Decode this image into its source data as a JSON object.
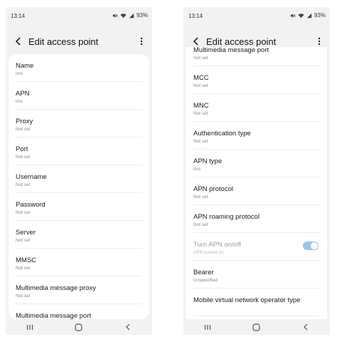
{
  "screens": [
    {
      "status": {
        "time": "13:14",
        "battery": "93%"
      },
      "title": "Edit access point",
      "items": [
        {
          "label": "Name",
          "value": "ims"
        },
        {
          "label": "APN",
          "value": "ims"
        },
        {
          "label": "Proxy",
          "value": "Not set"
        },
        {
          "label": "Port",
          "value": "Not set"
        },
        {
          "label": "Username",
          "value": "Not set"
        },
        {
          "label": "Password",
          "value": "Not set"
        },
        {
          "label": "Server",
          "value": "Not set"
        },
        {
          "label": "MMSC",
          "value": "Not set"
        },
        {
          "label": "Multimedia message proxy",
          "value": "Not set"
        },
        {
          "label": "Multimedia message port",
          "value": ""
        }
      ]
    },
    {
      "status": {
        "time": "13:14",
        "battery": "93%"
      },
      "title": "Edit access point",
      "items": [
        {
          "label": "Multimedia message port",
          "value": "Not set"
        },
        {
          "label": "MCC",
          "value": "Not set"
        },
        {
          "label": "MNC",
          "value": "Not set"
        },
        {
          "label": "Authentication type",
          "value": "Not set"
        },
        {
          "label": "APN type",
          "value": "ims"
        },
        {
          "label": "APN protocol",
          "value": "Not set"
        },
        {
          "label": "APN roaming protocol",
          "value": "Not set"
        },
        {
          "label": "Turn APN on/off",
          "value": "APN turned on",
          "toggle": true,
          "checked": true
        },
        {
          "label": "Bearer",
          "value": "Unspecified"
        },
        {
          "label": "Mobile virtual network operator type",
          "value": ""
        }
      ]
    }
  ],
  "colors": {
    "accent": "#9cc4f0",
    "background": "#f2f2f2",
    "card": "#ffffff"
  },
  "icons": [
    "mute-icon",
    "wifi-icon",
    "signal-icon",
    "back-arrow-icon",
    "more-vert-icon",
    "recents-icon",
    "home-icon",
    "nav-back-icon"
  ]
}
